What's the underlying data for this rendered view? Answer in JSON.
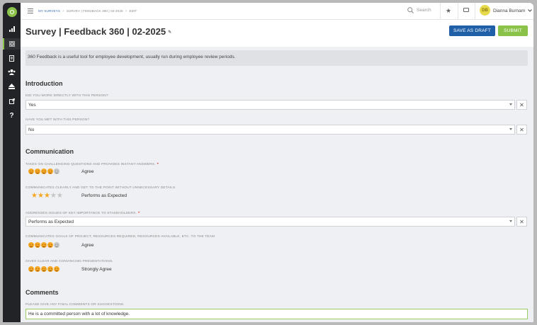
{
  "header": {
    "breadcrumbs": [
      "MY SURVEYS",
      "SURVEY | FEEDBACK 360 | 02-2025",
      "EDIT"
    ],
    "search_placeholder": "Search",
    "user_initials": "DB",
    "user_name": "Dianna Burnam"
  },
  "page": {
    "title": "Survey | Feedback 360 | 02-2025",
    "save_draft_label": "SAVE AS DRAFT",
    "submit_label": "SUBMIT",
    "description": "360 Feedback is a useful tool for employee development, usually run during employee review periods."
  },
  "sections": {
    "introduction": {
      "title": "Introduction",
      "q1": {
        "label": "DID YOU WORK DIRECTLY WITH THIS PERSON?",
        "value": "Yes"
      },
      "q2": {
        "label": "HAVE YOU MET WITH THIS PERSON?",
        "value": "No"
      }
    },
    "communication": {
      "title": "Communication",
      "q1": {
        "label": "TAKES ON CHALLENGING QUESTIONS AND PROVIDES INSTANT ANSWERS.",
        "required": true,
        "rating": 4,
        "max": 5,
        "value": "Agree"
      },
      "q2": {
        "label": "COMMUNICATES CLEARLY AND GET TO THE POINT WITHOUT UNNECESSARY DETAILS.",
        "rating": 3,
        "max": 5,
        "value": "Performs as Expected"
      },
      "q3": {
        "label": "ADDRESSES ISSUES OF KEY IMPORTANCE TO STAKEHOLDERS.",
        "required": true,
        "value": "Performs as Expected"
      },
      "q4": {
        "label": "COMMUNICATES GOALS OF PROJECT, RESOURCES REQUIRED, RESOURCES AVAILABLE, ETC. TO THE TEAM",
        "rating": 4,
        "max": 5,
        "value": "Agree"
      },
      "q5": {
        "label": "GIVES CLEAR AND CONVINCING PRESENTATIONS.",
        "rating": 5,
        "max": 5,
        "value": "Strongly Agree"
      }
    },
    "comments": {
      "title": "Comments",
      "q1": {
        "label": "PLEASE GIVE ANY FINAL COMMENTS OR SUGGESTIONS.",
        "value": "He is a committed person with a lot of knowledge."
      }
    }
  },
  "colors": {
    "accent_green": "#8bc34a",
    "primary_blue": "#1e5fa8",
    "rating_orange": "#f5a623",
    "required_red": "#e53935"
  },
  "icons": {
    "rail": [
      "logo-icon",
      "bar-chart-icon",
      "dashboard-icon",
      "document-icon",
      "users-icon",
      "inbox-icon",
      "external-link-icon",
      "help-icon"
    ],
    "header": [
      "menu-icon",
      "search-icon",
      "star-icon",
      "chat-icon",
      "chevron-down-icon"
    ]
  }
}
